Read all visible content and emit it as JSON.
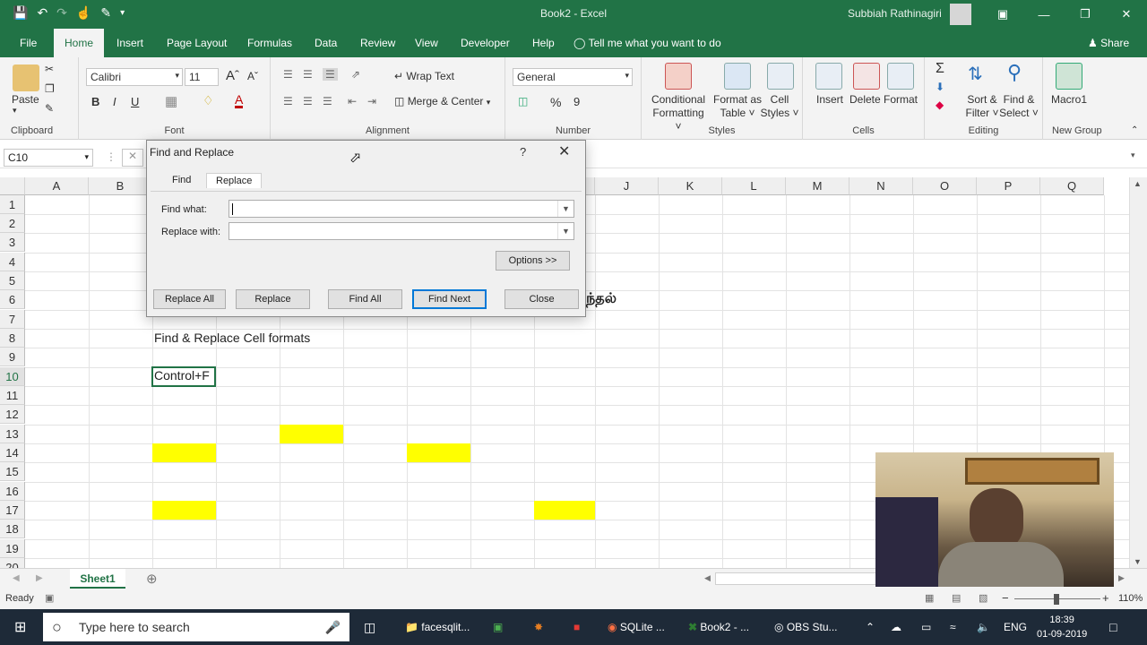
{
  "window": {
    "title": "Book2  -  Excel",
    "user": "Subbiah Rathinagiri"
  },
  "menu": {
    "tabs": [
      "File",
      "Home",
      "Insert",
      "Page Layout",
      "Formulas",
      "Data",
      "Review",
      "View",
      "Developer",
      "Help"
    ],
    "active": "Home",
    "tell_me": "Tell me what you want to do",
    "share": "Share"
  },
  "ribbon": {
    "clipboard": {
      "paste": "Paste",
      "label": "Clipboard"
    },
    "font": {
      "name": "Calibri",
      "size": "11",
      "label": "Font",
      "bold": "B",
      "italic": "I",
      "underline": "U",
      "color_glyph": "A"
    },
    "alignment": {
      "wrap_text": "Wrap Text",
      "merge_center": "Merge & Center",
      "label": "Alignment"
    },
    "number": {
      "format": "General",
      "label": "Number",
      "percent": "%",
      "comma": "9"
    },
    "styles": {
      "conditional": [
        "Conditional",
        "Formatting ˅"
      ],
      "format_table": [
        "Format as",
        "Table ˅"
      ],
      "cell_styles": [
        "Cell",
        "Styles ˅"
      ],
      "label": "Styles"
    },
    "cells": {
      "insert": "Insert",
      "delete": "Delete",
      "format": "Format",
      "label": "Cells"
    },
    "editing": {
      "sort": [
        "Sort &",
        "Filter ˅"
      ],
      "find": [
        "Find &",
        "Select ˅"
      ],
      "sigma": "Σ",
      "label": "Editing"
    },
    "newgroup": {
      "macro": "Macro1",
      "label": "New Group"
    }
  },
  "formula_bar": {
    "name_box": "C10"
  },
  "grid": {
    "columns": [
      "A",
      "B",
      "C",
      "D",
      "E",
      "F",
      "G",
      "H",
      "I",
      "J",
      "K",
      "L",
      "M",
      "N",
      "O",
      "P",
      "Q"
    ],
    "rows": [
      "1",
      "2",
      "3",
      "4",
      "5",
      "6",
      "7",
      "8",
      "9",
      "10",
      "11",
      "12",
      "13",
      "14",
      "15",
      "16",
      "17",
      "18",
      "19",
      "20"
    ],
    "selected_row": "10",
    "cells": {
      "c8": "Find & Replace Cell formats",
      "c10": "Control+F",
      "tamil_fragment": "ந்தல்"
    },
    "highlight_color": "#ffff00"
  },
  "dialog": {
    "title": "Find and Replace",
    "help": "?",
    "close": "✕",
    "tabs": [
      "Find",
      "Replace"
    ],
    "active_tab": "Replace",
    "find_what_label": "Find what:",
    "replace_with_label": "Replace with:",
    "find_what_value": "",
    "replace_with_value": "",
    "options": "Options >>",
    "buttons": [
      "Replace All",
      "Replace",
      "Find All",
      "Find Next",
      "Close"
    ]
  },
  "sheets": {
    "tabs": [
      "Sheet1"
    ],
    "add": "⊕"
  },
  "status": {
    "ready": "Ready",
    "zoom": "110%",
    "minus": "−",
    "plus": "+"
  },
  "taskbar": {
    "search_placeholder": "Type here to search",
    "items": [
      "facesqlit...",
      "SQLite ...",
      "Book2 - ...",
      "OBS Stu..."
    ],
    "lang": "ENG",
    "time": "18:39",
    "date": "01-09-2019"
  },
  "colors": {
    "excel_green": "#217346",
    "highlight": "#ffff00",
    "accent_blue": "#0078d7"
  }
}
